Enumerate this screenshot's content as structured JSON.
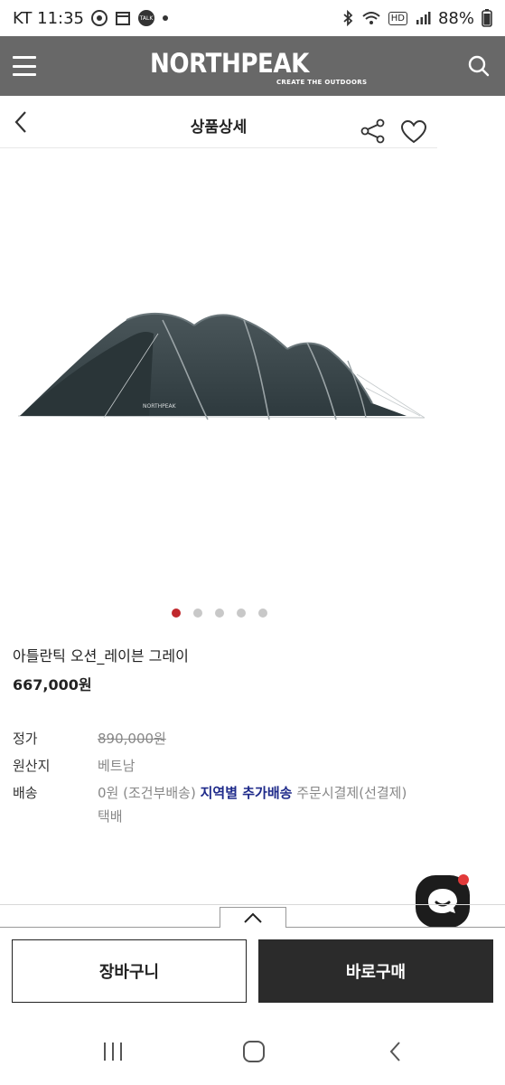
{
  "status_bar": {
    "carrier_time": "KT 11:35",
    "battery": "88%",
    "hd_label": "HD",
    "talk_label": "TALK",
    "icons": [
      "chrome-icon",
      "calendar-icon",
      "talk-icon",
      "dot-icon",
      "bluetooth-icon",
      "wifi-icon",
      "hd-icon",
      "signal-icon"
    ]
  },
  "brand": {
    "name": "NORTHPEAK",
    "tagline": "CREATE THE OUTDOORS",
    "header_color": "#686868"
  },
  "page_header": {
    "title": "상품상세"
  },
  "product": {
    "image_logo_text": "NORTHPEAK",
    "carousel_count": 5,
    "carousel_active": 1,
    "name": "아틀란틱 오션_레이븐 그레이",
    "price": "667,000원"
  },
  "info": {
    "list_price_label": "정가",
    "list_price_value": "890,000원",
    "origin_label": "원산지",
    "origin_value": "베트남",
    "shipping_label": "배송",
    "shipping_free": "0원 (조건부배송)",
    "shipping_link": "지역별 추가배송",
    "shipping_rest": "주문시결제(선결제)",
    "shipping_method": "택배"
  },
  "actions": {
    "cart_label": "장바구니",
    "buy_label": "바로구매"
  },
  "colors": {
    "accent_dot": "#c0282d",
    "link_blue": "#1e2a8a",
    "buy_button": "#2b2b2b"
  }
}
